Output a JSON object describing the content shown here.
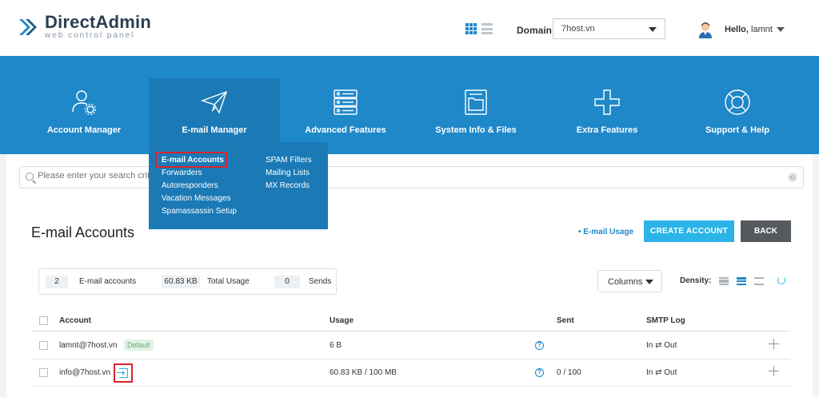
{
  "header": {
    "logo_title": "DirectAdmin",
    "logo_subtitle": "web control panel",
    "domain_label": "Domain",
    "domain_value": "7host.vn",
    "greeting": "Hello,",
    "username": "lamnt"
  },
  "nav": {
    "items": [
      {
        "label": "Account Manager",
        "icon": "account-manager-icon"
      },
      {
        "label": "E-mail Manager",
        "icon": "paper-plane-icon"
      },
      {
        "label": "Advanced Features",
        "icon": "server-icon"
      },
      {
        "label": "System Info & Files",
        "icon": "folder-icon"
      },
      {
        "label": "Extra Features",
        "icon": "plus-icon"
      },
      {
        "label": "Support & Help",
        "icon": "lifebuoy-icon"
      }
    ]
  },
  "email_menu": {
    "left": [
      "E-mail Accounts",
      "Forwarders",
      "Autoresponders",
      "Vacation Messages",
      "Spamassassin Setup"
    ],
    "right": [
      "SPAM Filters",
      "Mailing Lists",
      "MX Records"
    ]
  },
  "search": {
    "placeholder": "Please enter your search criteria"
  },
  "page": {
    "title": "E-mail Accounts",
    "usage_link": "• E-mail Usage",
    "create_button": "CREATE ACCOUNT",
    "back_button": "BACK"
  },
  "stats": {
    "accounts_count": "2",
    "accounts_label": "E-mail accounts",
    "usage_value": "60.83 KB",
    "usage_label": "Total Usage",
    "sends_value": "0",
    "sends_label": "Sends"
  },
  "toolbar": {
    "columns_label": "Columns",
    "density_label": "Density:"
  },
  "table": {
    "headers": {
      "account": "Account",
      "usage": "Usage",
      "sent": "Sent",
      "smtp": "SMTP Log"
    },
    "rows": [
      {
        "account": "lamnt@7host.vn",
        "badge": "Default",
        "usage": "6 B",
        "sent": "",
        "smtp": "In ⇄ Out"
      },
      {
        "account": "info@7host.vn",
        "badge": "",
        "usage": "60.83 KB / 100 MB",
        "sent": "0 / 100",
        "smtp": "In ⇄ Out"
      }
    ]
  },
  "colors": {
    "primary": "#1f88c9",
    "nav_active": "#1b7ab6",
    "create_button": "#2ab4e8",
    "back_button": "#555a5f",
    "highlight": "#d9232e"
  }
}
